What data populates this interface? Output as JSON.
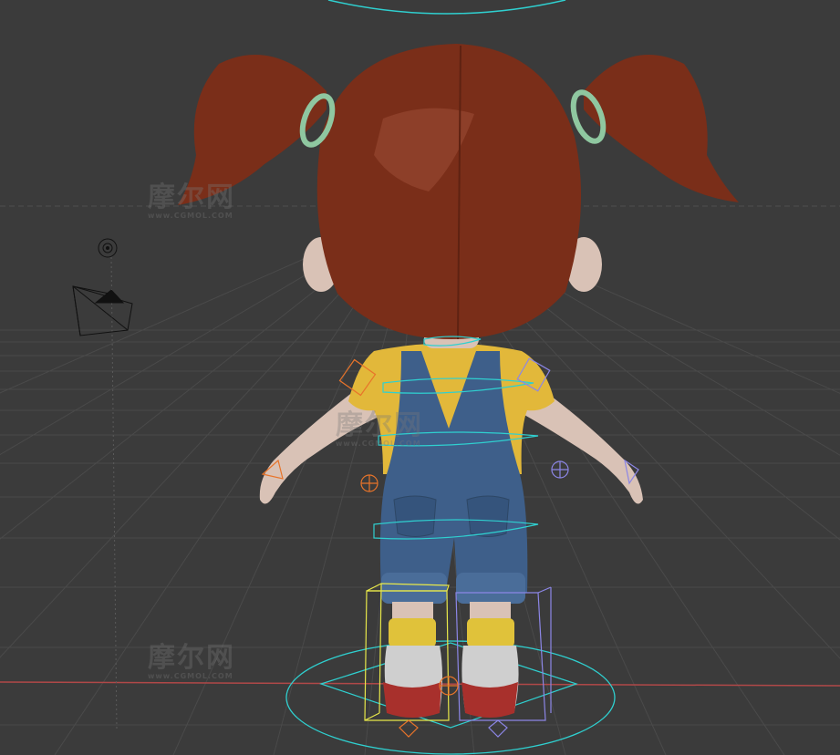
{
  "viewport": {
    "background": "#3b3b3b",
    "grid_color": "#4a4a4a",
    "x_axis_color": "#b04848",
    "y_axis_color": "#8a8a8a",
    "rig_color_cyan": "#2fd0d0",
    "rig_color_yellow": "#e8e84a",
    "rig_color_orange": "#e8742a",
    "rig_color_violet": "#8c86e6"
  },
  "character": {
    "hair_color": "#7a2e19",
    "skin_color": "#d9c2b6",
    "shirt_color": "#e2b83a",
    "overalls_color": "#3e5f8a",
    "sock_color": "#e0c23a",
    "shoe_color": "#a8302c",
    "hair_tie_color": "#8fc7a0"
  },
  "watermarks": [
    {
      "text": "摩尔网",
      "sub": "www.CGMOL.COM"
    },
    {
      "text": "摩尔网",
      "sub": "www.CGMOL.COM"
    },
    {
      "text": "摩尔网",
      "sub": "www.CGMOL.COM"
    }
  ]
}
